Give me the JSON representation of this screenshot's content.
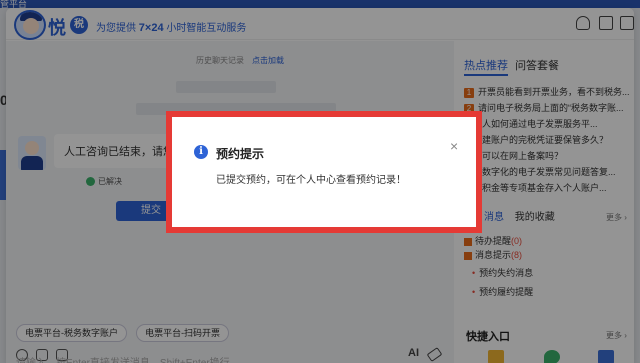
{
  "background": {
    "edge_text": "管平台",
    "left_digit": "0"
  },
  "header": {
    "brand": "悦",
    "brand_badge": "税",
    "tagline_prefix": "为您提供",
    "tagline_highlight": "7×24",
    "tagline_suffix": "小时智能互动服务"
  },
  "chat": {
    "history_label": "历史聊天记录",
    "history_link": "点击加载",
    "agent_message": "人工咨询已结束，请您",
    "resolved_label": "已解决",
    "submit_label": "提交",
    "chips": [
      "电票平台-税务数字账户",
      "电票平台-扫码开票"
    ],
    "input_placeholder": "请输入，按Enter直接发送消息，Shift+Enter换行"
  },
  "side": {
    "tabs": [
      "热点推荐",
      "问答套餐"
    ],
    "hot_items": [
      {
        "num": "1",
        "text": "开票员能看到开票业务，看不到税务..."
      },
      {
        "num": "2",
        "text": "请问电子税务局上面的“税务数字账..."
      },
      {
        "num": "",
        "text": "纳税人如何通过电子发票服务平..."
      },
      {
        "num": "",
        "text": "个体建账户的完税凭证要保管多久？"
      },
      {
        "num": "",
        "text": "账户可以在网上备案吗？"
      },
      {
        "num": "",
        "text": "全面数字化的电子发票常见问题答复..."
      },
      {
        "num": "",
        "text": "税公积金等专项基金存入个人账户..."
      }
    ],
    "msg_tabs": [
      "消息",
      "我的收藏"
    ],
    "more_label": "更多 ›",
    "notices": [
      {
        "label": "待办提醒",
        "count": "(0)"
      },
      {
        "label": "消息提示",
        "count": "(8)"
      }
    ],
    "sub_items": [
      "预约失约消息",
      "预约履约提醒"
    ],
    "quick_title": "快捷入口",
    "quick_more": "更多 ›"
  },
  "modal": {
    "title": "预约提示",
    "message": "已提交预约，可在个人中心查看预约记录！",
    "close": "×"
  },
  "colors": {
    "accent": "#2e63d6",
    "highlight_border": "#e53a35",
    "overlay": "rgba(0,0,0,0.42)"
  }
}
